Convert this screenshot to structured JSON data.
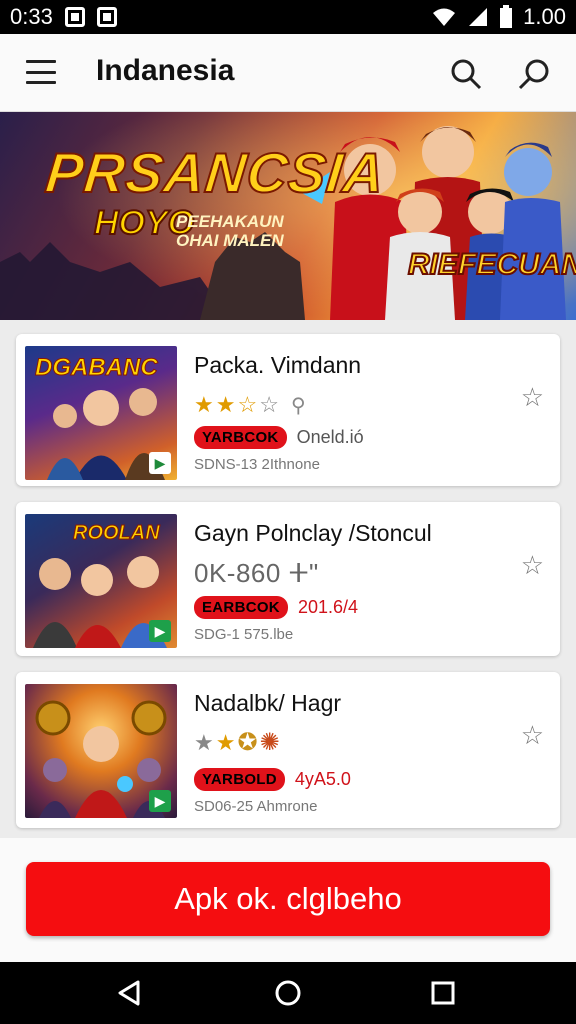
{
  "status_bar": {
    "time": "0:33",
    "battery": "1.00"
  },
  "app_bar": {
    "title": "Indanesia",
    "menu_icon": "menu-icon",
    "search_icon": "search-icon",
    "search2_icon": "search-icon"
  },
  "banner": {
    "title": "PRSANCSIA",
    "subtitle": "HOYO",
    "subtitle_small": "PEEHAKAUN\nOHAI MALEN",
    "badge": "RIEFECUAN"
  },
  "thumb_labels": [
    "DGABANC",
    "ROOLAN",
    ""
  ],
  "cards": [
    {
      "title": "Packa. Vimdann",
      "rating_stars": 3,
      "tag": "YARBCOK",
      "tag_value": "Oneld.ió",
      "meta": "SDNS-13 2Ithnone"
    },
    {
      "title": "Gayn Polnclay /Stoncul",
      "price": "0K-860 ⵜ\"",
      "tag": "EARBCOK",
      "tag_value": "201.6/4",
      "meta": "SDG-1 575.lbe"
    },
    {
      "title": "Nadalbk/ Hagr",
      "rating_stars": 2,
      "tag": "YARBOLD",
      "tag_value": "4yA5.0",
      "meta": "SD06-25 Ahmrone"
    }
  ],
  "cta": {
    "label": "Apk ok. clglbeho"
  },
  "colors": {
    "accent": "#f50d10",
    "tag": "#e0121a",
    "star": "#e09b00"
  }
}
